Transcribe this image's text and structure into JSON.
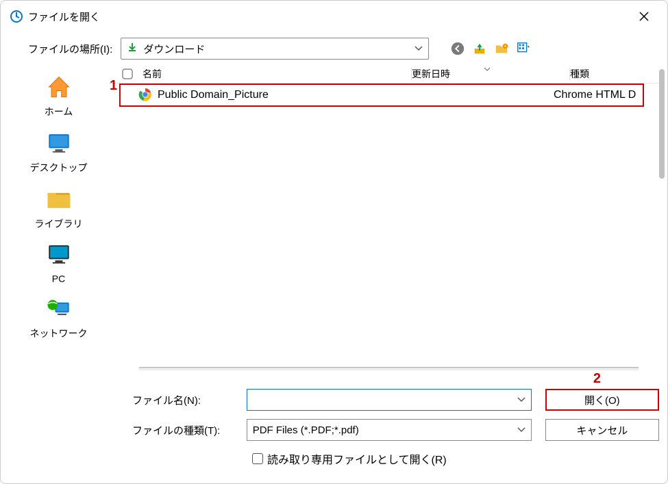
{
  "window": {
    "title": "ファイルを開く"
  },
  "toolbar": {
    "location_label": "ファイルの場所(I):",
    "location_value": "ダウンロード"
  },
  "sidebar": {
    "home": "ホーム",
    "desktop": "デスクトップ",
    "library": "ライブラリ",
    "pc": "PC",
    "network": "ネットワーク"
  },
  "columns": {
    "name": "名前",
    "date": "更新日時",
    "type": "種類"
  },
  "files": [
    {
      "name": "Public Domain_Picture",
      "date": "",
      "type": "Chrome HTML D"
    }
  ],
  "form": {
    "filename_label": "ファイル名(N):",
    "filename_value": "",
    "filetype_label": "ファイルの種類(T):",
    "filetype_value": "PDF Files (*.PDF;*.pdf)",
    "open_button": "開く(O)",
    "cancel_button": "キャンセル",
    "readonly_label": "読み取り専用ファイルとして開く(R)"
  },
  "annotations": {
    "one": "1",
    "two": "2"
  }
}
